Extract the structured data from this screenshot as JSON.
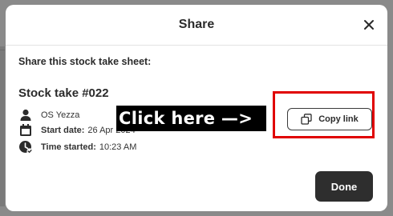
{
  "modal": {
    "title": "Share",
    "intro": "Share this stock take sheet:",
    "sheet_name": "Stock take #022",
    "owner": "OS Yezza",
    "start_date_label": "Start date:",
    "start_date_value": "26 Apr 2024",
    "time_started_label": "Time started:",
    "time_started_value": "10:23 AM",
    "copy_link_label": "Copy link",
    "done_label": "Done"
  },
  "annotation": {
    "callout_text": "Click here —>",
    "highlight_color": "#e00000"
  },
  "icons": {
    "close": "close-icon",
    "user": "user-icon",
    "calendar": "calendar-icon",
    "clock": "clock-check-icon",
    "copy": "copy-icon"
  },
  "colors": {
    "primary_button": "#2e2e2e",
    "backdrop": "#8a8a8a"
  }
}
